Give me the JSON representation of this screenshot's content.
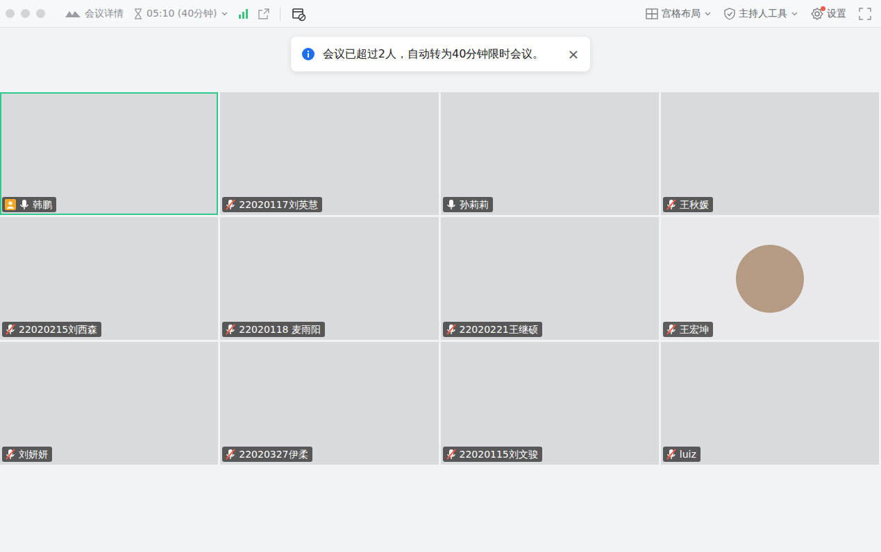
{
  "toolbar": {
    "meeting_info": "会议详情",
    "timer": "05:10 (40分钟)",
    "layout": "宫格布局",
    "host_tools": "主持人工具",
    "settings": "设置",
    "settings_badge": true
  },
  "notice": {
    "text": "会议已超过2人，自动转为40分钟限时会议。",
    "close": "×"
  },
  "participants": [
    {
      "name": "韩鹏",
      "muted": false,
      "host": true,
      "speaking": true,
      "kind": "video"
    },
    {
      "name": "22020117刘英慧",
      "muted": true,
      "host": false,
      "speaking": false,
      "kind": "video"
    },
    {
      "name": "孙莉莉",
      "muted": false,
      "host": false,
      "speaking": false,
      "kind": "video"
    },
    {
      "name": "王秋媛",
      "muted": true,
      "host": false,
      "speaking": false,
      "kind": "video"
    },
    {
      "name": "22020215刘西森",
      "muted": true,
      "host": false,
      "speaking": false,
      "kind": "video"
    },
    {
      "name": "22020118  麦雨阳",
      "muted": true,
      "host": false,
      "speaking": false,
      "kind": "video"
    },
    {
      "name": "22020221王继硕",
      "muted": true,
      "host": false,
      "speaking": false,
      "kind": "video"
    },
    {
      "name": "王宏坤",
      "muted": true,
      "host": false,
      "speaking": false,
      "kind": "avatar"
    },
    {
      "name": "刘妍妍",
      "muted": true,
      "host": false,
      "speaking": false,
      "kind": "video"
    },
    {
      "name": "22020327伊柔",
      "muted": true,
      "host": false,
      "speaking": false,
      "kind": "video"
    },
    {
      "name": "22020115刘文骏",
      "muted": true,
      "host": false,
      "speaking": false,
      "kind": "video"
    },
    {
      "name": "luiz",
      "muted": true,
      "host": false,
      "speaking": false,
      "kind": "video"
    }
  ]
}
